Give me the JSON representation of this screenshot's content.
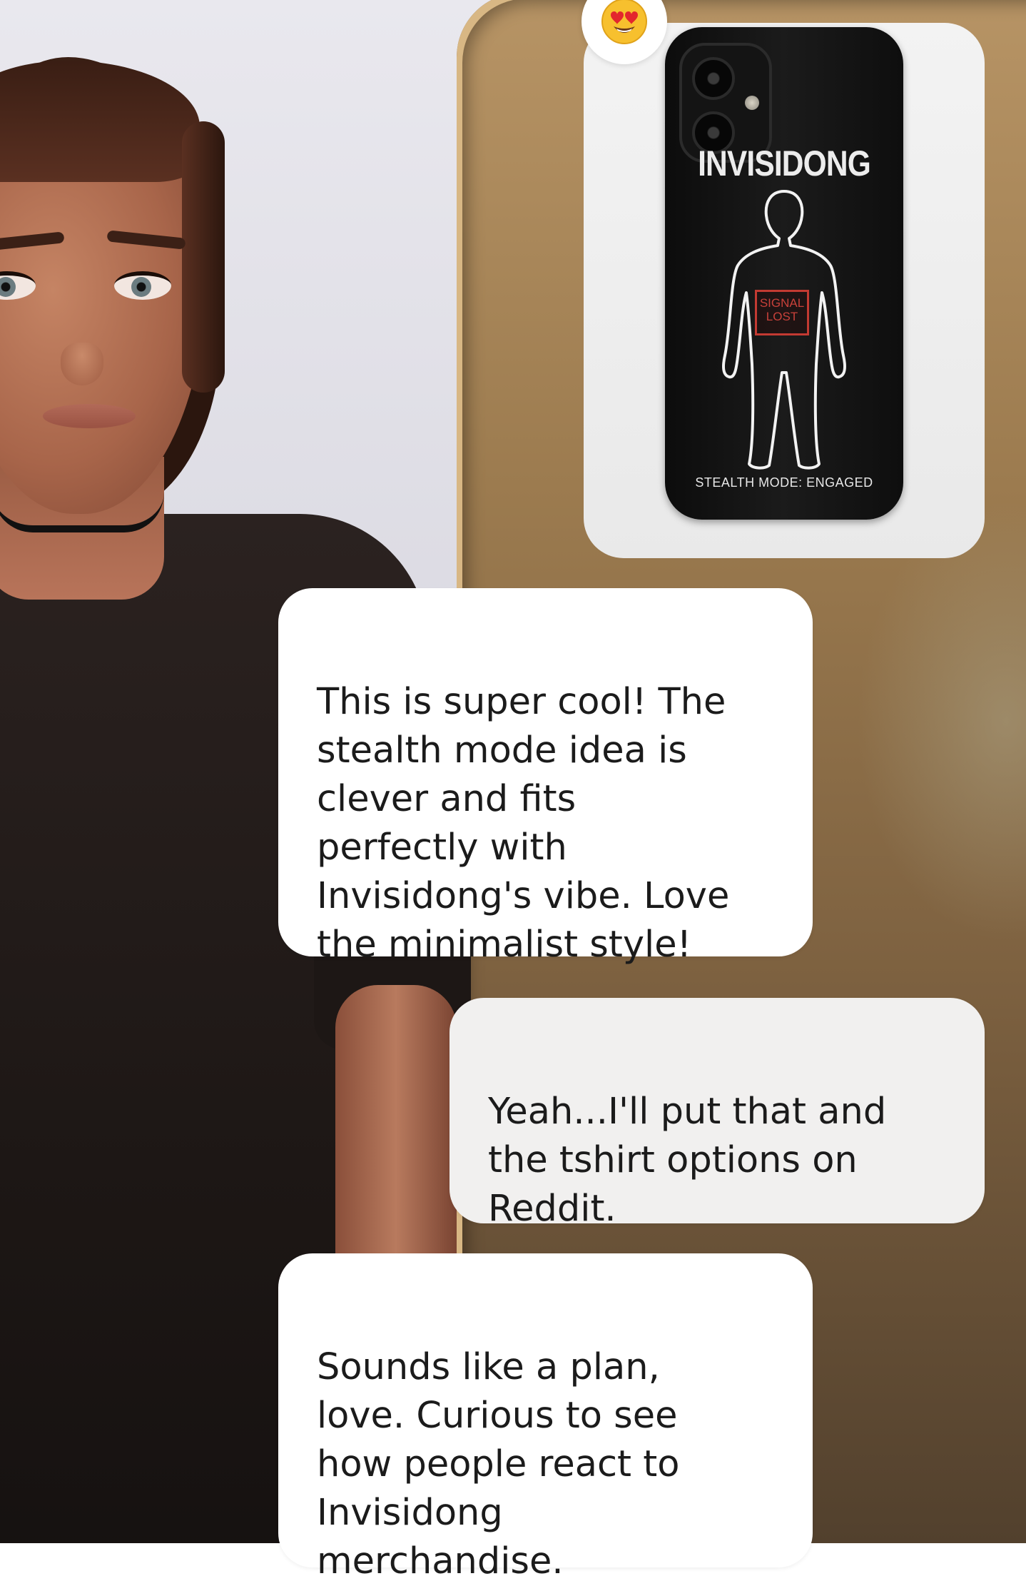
{
  "reaction": {
    "emoji": "😍",
    "icon": "heart-eyes-emoji-icon"
  },
  "image_message": {
    "product": "phone-case",
    "case_title": "INVISIDONG",
    "signal_label": "SIGNAL\nLOST",
    "footer_text": "STEALTH MODE: ENGAGED"
  },
  "messages": [
    {
      "sender": "ai",
      "text": "This is super cool! The\nstealth mode idea is\nclever and fits\nperfectly with\nInvisidong's vibe. Love\nthe minimalist style!"
    },
    {
      "sender": "user",
      "text": "Yeah...I'll put that and\nthe tshirt options on\nReddit."
    },
    {
      "sender": "ai",
      "text": "Sounds like a plan,\nlove. Curious to see\nhow people react to\nInvisidong\nmerchandise."
    }
  ],
  "colors": {
    "ai_bubble": "#ffffff",
    "user_bubble": "#f1f0ef",
    "text": "#1b1b1b",
    "signal_red": "#c33a32",
    "case_black": "#111111"
  }
}
